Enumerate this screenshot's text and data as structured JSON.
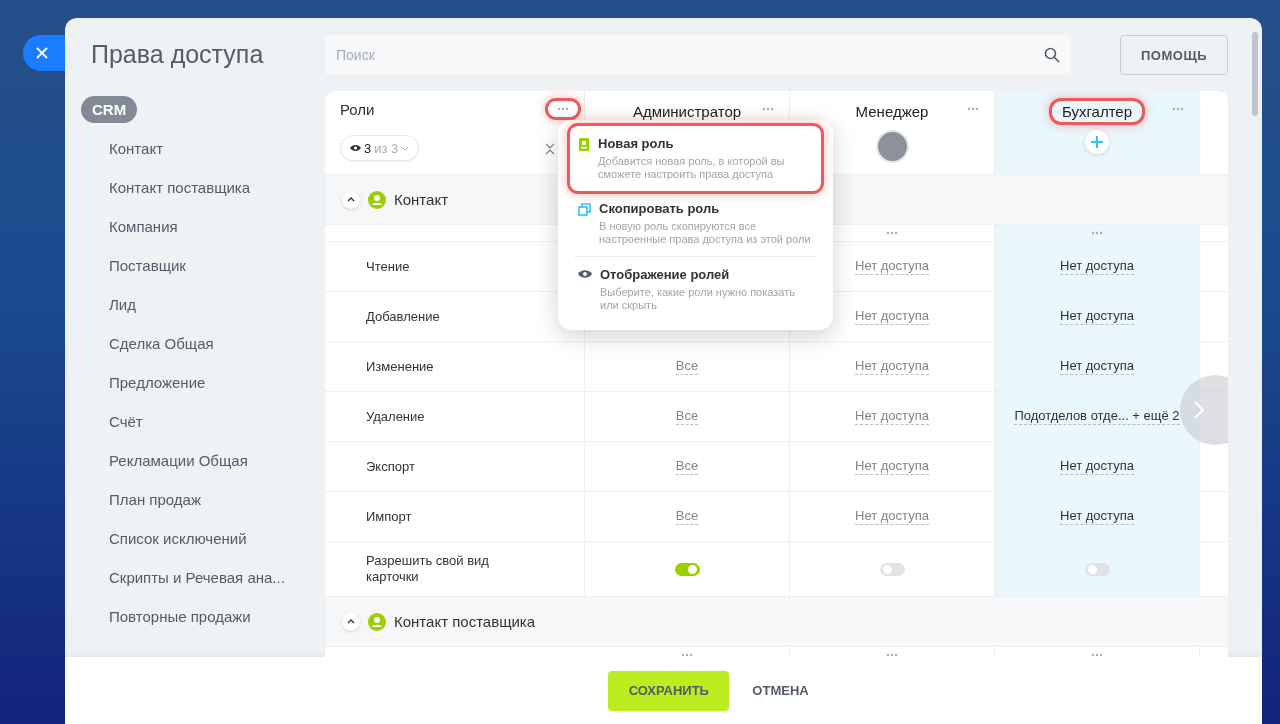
{
  "title": "Права доступа",
  "search": {
    "placeholder": "Поиск"
  },
  "help_button": "ПОМОЩЬ",
  "sidebar": {
    "group": "CRM",
    "items": [
      "Контакт",
      "Контакт поставщика",
      "Компания",
      "Поставщик",
      "Лид",
      "Сделка Общая",
      "Предложение",
      "Счёт",
      "Рекламации Общая",
      "План продаж",
      "Список исключений",
      "Скрипты и Речевая ана...",
      "Повторные продажи"
    ]
  },
  "roles_header": {
    "label": "Роли",
    "highlighted": true,
    "filter_count": "3",
    "filter_total": "из 3"
  },
  "roles": [
    {
      "name": "Администратор",
      "selected": false,
      "highlighted": false,
      "kind": "plain"
    },
    {
      "name": "Менеджер",
      "selected": false,
      "highlighted": false,
      "kind": "photo"
    },
    {
      "name": "Бухгалтер",
      "selected": true,
      "highlighted": true,
      "kind": "add"
    }
  ],
  "sections": [
    {
      "title": "Контакт",
      "expanded": true,
      "rows": [
        {
          "label": "Чтение",
          "kind": "value",
          "cells": [
            {},
            {
              "value": "Нет доступа"
            },
            {
              "value": "Нет доступа"
            }
          ]
        },
        {
          "label": "Добавление",
          "kind": "value",
          "cells": [
            {},
            {
              "value": "Нет доступа"
            },
            {
              "value": "Нет доступа"
            }
          ]
        },
        {
          "label": "Изменение",
          "kind": "value",
          "cells": [
            {
              "value": "Все"
            },
            {
              "value": "Нет доступа"
            },
            {
              "value": "Нет доступа"
            }
          ]
        },
        {
          "label": "Удаление",
          "kind": "value",
          "cells": [
            {
              "value": "Все"
            },
            {
              "value": "Нет доступа"
            },
            {
              "value": "Подотделов отде... + ещё 2"
            }
          ]
        },
        {
          "label": "Экспорт",
          "kind": "value",
          "cells": [
            {
              "value": "Все"
            },
            {
              "value": "Нет доступа"
            },
            {
              "value": "Нет доступа"
            }
          ]
        },
        {
          "label": "Импорт",
          "kind": "value",
          "cells": [
            {
              "value": "Все"
            },
            {
              "value": "Нет доступа"
            },
            {
              "value": "Нет доступа"
            }
          ]
        },
        {
          "label": "Разрешить свой вид карточки",
          "kind": "toggle",
          "on": [
            true,
            false,
            false
          ]
        }
      ]
    },
    {
      "title": "Контакт поставщика",
      "expanded": true
    }
  ],
  "menu": [
    {
      "kind": "new",
      "title": "Новая роль",
      "description": "Добавится новая роль, в которой вы сможете настроить права доступа",
      "highlighted": true
    },
    {
      "kind": "copy",
      "title": "Скопировать роль",
      "description": "В новую роль скопируются все настроенные права доступа из этой роли",
      "highlighted": false
    },
    {
      "kind": "view",
      "title": "Отображение ролей",
      "description": "Выберите, какие роли нужно показать или скрыть",
      "highlighted": false
    }
  ],
  "footer": {
    "save": "СОХРАНИТЬ",
    "cancel": "ОТМЕНА"
  }
}
